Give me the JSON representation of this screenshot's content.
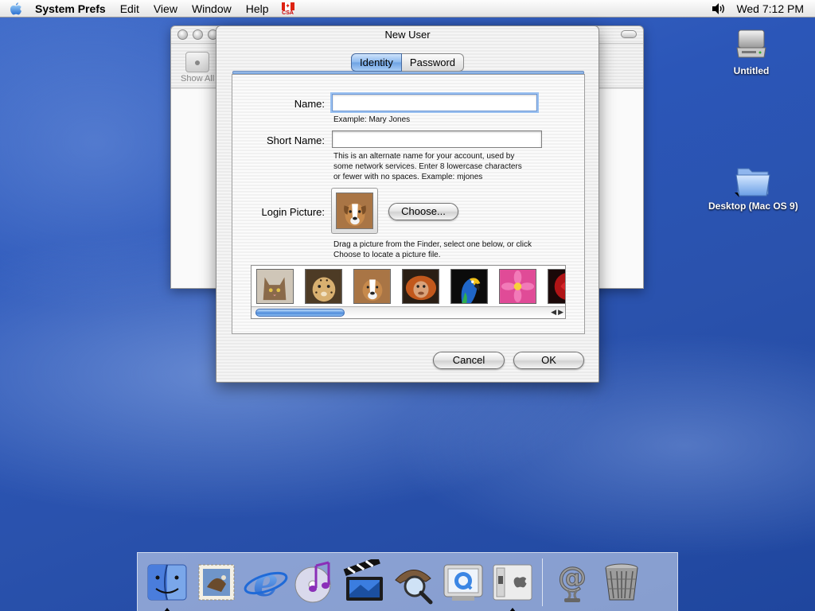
{
  "menubar": {
    "app_name": "System Prefs",
    "menus": [
      "Edit",
      "View",
      "Window",
      "Help"
    ],
    "input_menu_label": "CSA",
    "clock": "Wed 7:12 PM"
  },
  "desktop": {
    "icons": [
      {
        "label": "Untitled",
        "icon": "hard-drive-icon"
      },
      {
        "label": "Desktop (Mac OS 9)",
        "icon": "folder-icon"
      }
    ]
  },
  "bg_window": {
    "toolbar_item": "Show All"
  },
  "sheet": {
    "title": "New User",
    "tabs": [
      {
        "label": "Identity",
        "active": true
      },
      {
        "label": "Password",
        "active": false
      }
    ],
    "name_label": "Name:",
    "name_value": "",
    "name_hint": "Example: Mary Jones",
    "short_name_label": "Short Name:",
    "short_name_value": "",
    "short_name_hint_1": "This is an alternate name for your account, used by",
    "short_name_hint_2": "some network services. Enter 8 lowercase characters",
    "short_name_hint_3": "or fewer with no spaces. Example: mjones",
    "picture_label": "Login Picture:",
    "choose_button": "Choose...",
    "picture_hint_1": "Drag a picture from the Finder, select one below, or click",
    "picture_hint_2": "Choose to locate a picture file.",
    "pictures": [
      "cat",
      "cheetah",
      "dog",
      "orangutan",
      "parrot",
      "flower",
      "rose"
    ],
    "cancel_button": "Cancel",
    "ok_button": "OK",
    "accent_color": "#6da2e3"
  },
  "dock": {
    "apps": [
      "finder-icon",
      "mail-icon",
      "internet-explorer-icon",
      "itunes-icon",
      "imovie-icon",
      "sherlock-icon",
      "quicktime-icon",
      "system-preferences-icon"
    ],
    "docs": [
      "internet-location-icon",
      "trash-icon"
    ]
  }
}
